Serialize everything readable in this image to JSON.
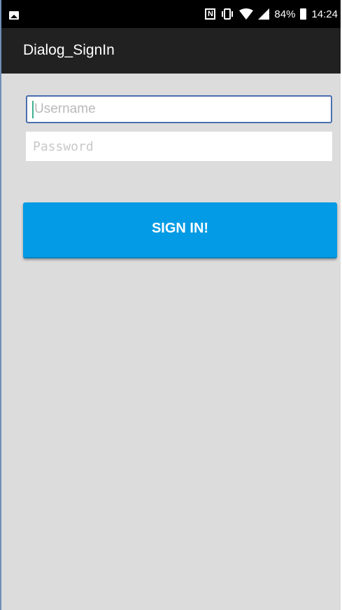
{
  "status_bar": {
    "left_icon": "image-icon",
    "icons": [
      "nfc-icon",
      "vibrate-icon",
      "wifi-icon",
      "signal-icon"
    ],
    "battery_text": "84%",
    "battery_icon": "battery-icon",
    "time": "14:24"
  },
  "app_bar": {
    "title": "Dialog_SignIn"
  },
  "form": {
    "username_placeholder": "Username",
    "username_value": "",
    "password_placeholder": "Password",
    "password_value": "",
    "submit_label": "SIGN IN!"
  },
  "colors": {
    "background": "#dcdcdc",
    "app_bar": "#212121",
    "status_bar": "#000000",
    "button": "#039be5",
    "focus_border": "#4a6fae"
  }
}
